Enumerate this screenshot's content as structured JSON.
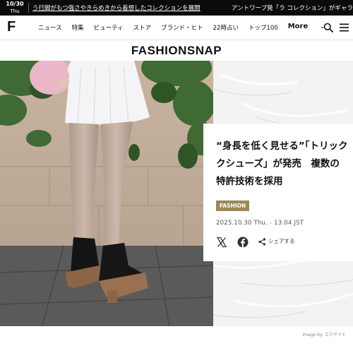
{
  "ticker": {
    "date": "10/30",
    "day": "Thu",
    "headline_left": "う行脚がもつ強さやきらめきから着想したコレクションを展開",
    "headline_right": "アントワープ発「ラ コレクション」がギャラ"
  },
  "nav": {
    "logo": "F",
    "items": [
      "ニュース",
      "特集",
      "ビューティ",
      "ストア",
      "ブランド・ヒト",
      "22時占い",
      "トップ100"
    ],
    "more_label": "More"
  },
  "brand": {
    "wordmark": "FASHIONSNAP"
  },
  "article": {
    "headline_lines": [
      "“身長を低く見せる”「トリック",
      "クシューズ」が発売　複数の",
      "特許技術を採用"
    ],
    "category": "FASHION",
    "published": "2025.10.30 Thu. - 13:04 JST",
    "share_label": "シェアする"
  },
  "image_credit": "Image by: エクサイト",
  "colors": {
    "accent": "#9a8a53",
    "ticker_bg": "#0b0b0b"
  }
}
